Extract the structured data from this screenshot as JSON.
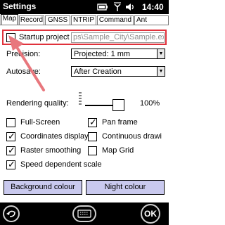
{
  "titlebar": {
    "title": "Settings",
    "time": "14:40"
  },
  "tabs": [
    {
      "label": "Map",
      "active": true
    },
    {
      "label": "Record"
    },
    {
      "label": "GNSS"
    },
    {
      "label": "NTRIP"
    },
    {
      "label": "Command"
    },
    {
      "label": "Ant"
    }
  ],
  "map_settings": {
    "startup_project_label": "Startup project",
    "startup_project_checked": false,
    "startup_project_path": "ps\\Sample_City\\Sample.exp",
    "precision_label": "Precision:",
    "precision_value": "Projected: 1 mm",
    "autosave_label": "Autosave:",
    "autosave_value": "After Creation",
    "rendering_quality_label": "Rendering quality:",
    "rendering_quality_value": "100%",
    "rendering_quality_level": 1.0,
    "checkboxes": [
      {
        "label": "Full-Screen",
        "checked": false
      },
      {
        "label": "Pan frame",
        "checked": true
      },
      {
        "label": "Coordinates display",
        "checked": true
      },
      {
        "label": "Continuous drawi",
        "checked": false
      },
      {
        "label": "Raster smoothing",
        "checked": true
      },
      {
        "label": "Map Grid",
        "checked": false
      },
      {
        "label": "Speed dependent scale",
        "checked": true
      }
    ],
    "background_colour_label": "Background colour",
    "night_colour_label": "Night colour"
  },
  "bottombar": {
    "ok_label": "OK"
  },
  "colors": {
    "highlight": "#e0323c",
    "arrow": "#e8777d",
    "button_bg": "#c9c9ee"
  }
}
